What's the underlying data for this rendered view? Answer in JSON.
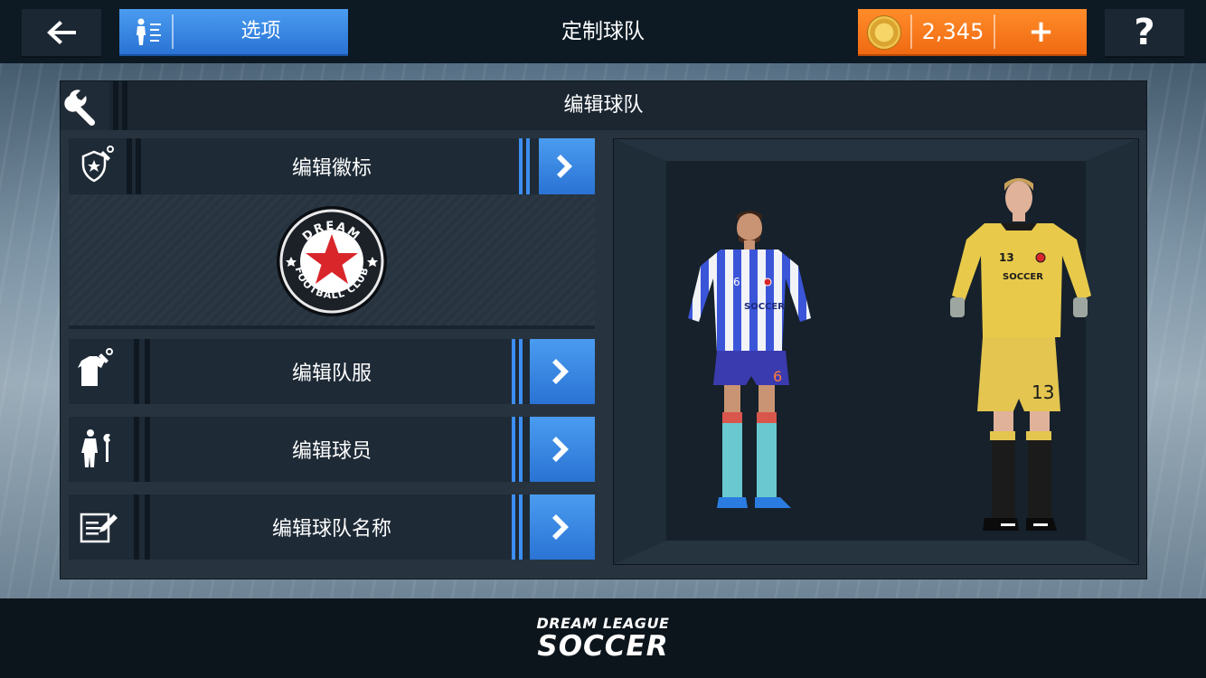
{
  "header": {
    "options_label": "选项",
    "title": "定制球队",
    "coins": "2,345",
    "plus_label": "+",
    "help_label": "?"
  },
  "panel": {
    "title": "编辑球队",
    "menu": [
      {
        "label": "编辑徽标",
        "icon": "crest-edit-icon"
      },
      {
        "label": "编辑队服",
        "icon": "shirt-edit-icon"
      },
      {
        "label": "编辑球员",
        "icon": "player-edit-icon"
      },
      {
        "label": "编辑球队名称",
        "icon": "name-edit-icon"
      }
    ],
    "crest": {
      "top_text": "DREAM",
      "bottom_text": "FOOTBALL CLUB"
    }
  },
  "players": {
    "outfield_number": "6",
    "goalkeeper_number": "13",
    "shirt_brand": "SOCCER"
  },
  "footer": {
    "logo_line1": "DREAM LEAGUE",
    "logo_line2": "SOCCER"
  },
  "colors": {
    "accent_blue": "#2f82e0",
    "coin_orange": "#f27a1e",
    "panel_dark": "#27343f",
    "kit_home": "#3b55d9",
    "kit_gk": "#e8c94a"
  }
}
